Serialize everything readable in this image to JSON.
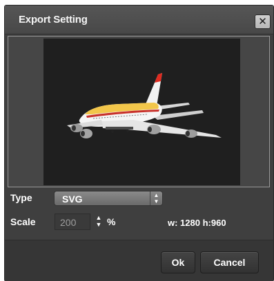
{
  "dialog": {
    "title": "Export Setting",
    "close_icon": "close-icon"
  },
  "preview": {
    "image": "airplane-image"
  },
  "type": {
    "label": "Type",
    "selected": "SVG"
  },
  "scale": {
    "label": "Scale",
    "value": "200",
    "unit": "%",
    "dimensions": "w: 1280 h:960"
  },
  "buttons": {
    "ok": "Ok",
    "cancel": "Cancel"
  }
}
